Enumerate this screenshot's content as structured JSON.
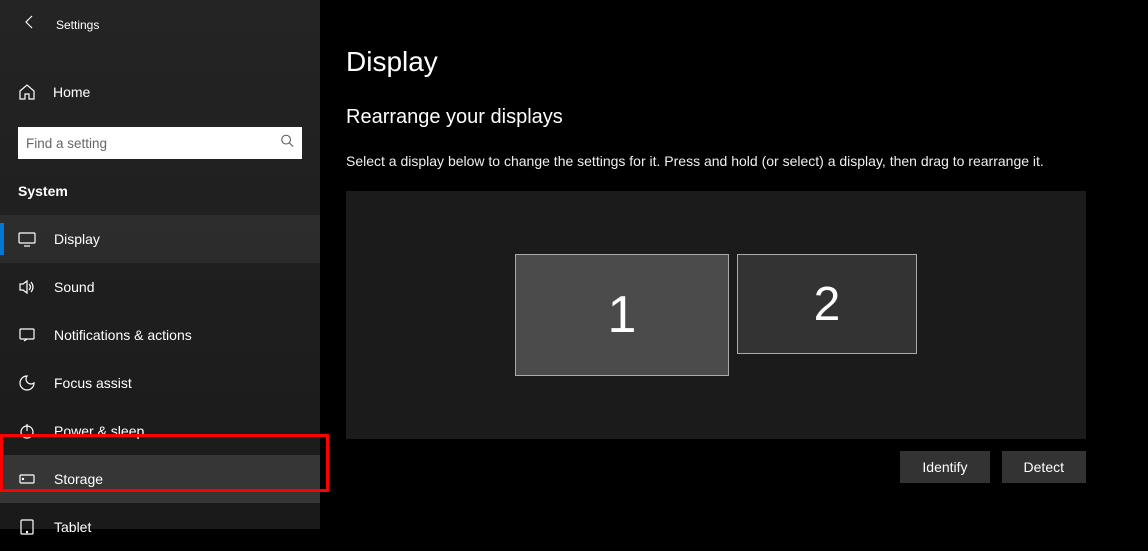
{
  "header": {
    "title": "Settings"
  },
  "home": {
    "label": "Home"
  },
  "search": {
    "placeholder": "Find a setting"
  },
  "category": {
    "label": "System"
  },
  "nav": {
    "items": [
      {
        "label": "Display"
      },
      {
        "label": "Sound"
      },
      {
        "label": "Notifications & actions"
      },
      {
        "label": "Focus assist"
      },
      {
        "label": "Power & sleep"
      },
      {
        "label": "Storage"
      },
      {
        "label": "Tablet"
      }
    ]
  },
  "main": {
    "title": "Display",
    "section_heading": "Rearrange your displays",
    "section_desc": "Select a display below to change the settings for it. Press and hold (or select) a display, then drag to rearrange it.",
    "displays": [
      {
        "id": "1"
      },
      {
        "id": "2"
      }
    ],
    "identify_label": "Identify",
    "detect_label": "Detect"
  }
}
